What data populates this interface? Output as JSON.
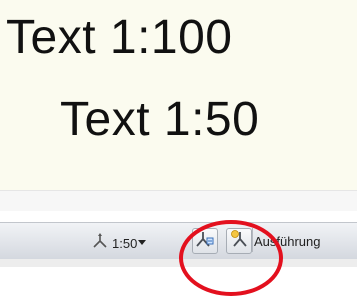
{
  "drawing": {
    "text_line_1": "Text 1:100",
    "text_line_2": "Text 1:50"
  },
  "status_bar": {
    "annotation_scale": {
      "icon": "annotation-scale-icon",
      "value": "1:50",
      "dropdown_icon": "triangle-down-icon"
    },
    "buttons": [
      {
        "name": "annotation-visibility-icon"
      },
      {
        "name": "auto-add-scale-icon"
      }
    ],
    "workspace_label": "Ausführung"
  },
  "highlight": {
    "shape": "circle",
    "color": "#e3101e"
  }
}
